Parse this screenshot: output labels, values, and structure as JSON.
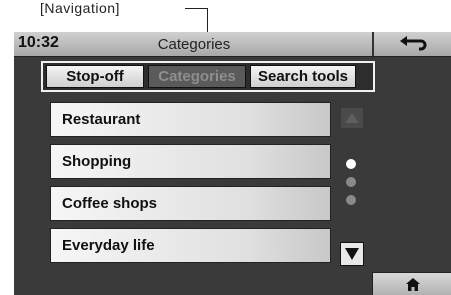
{
  "callout": {
    "label": "[Navigation]"
  },
  "header": {
    "time": "10:32",
    "title": "Categories"
  },
  "tabs": [
    {
      "label": "Stop-off",
      "state": "active"
    },
    {
      "label": "Categories",
      "state": "selected-dimmed"
    },
    {
      "label": "Search tools",
      "state": "active"
    }
  ],
  "list": {
    "items": [
      {
        "label": "Restaurant"
      },
      {
        "label": "Shopping"
      },
      {
        "label": "Coffee shops"
      },
      {
        "label": "Everyday life"
      }
    ]
  },
  "scroll": {
    "page": 1,
    "page_count": 3
  },
  "icons": {
    "back": "back-arrow-icon",
    "home": "home-icon",
    "up": "up-arrow-icon",
    "down": "down-arrow-icon"
  },
  "colors": {
    "screen_bg": "#3a3a3a",
    "item_bg": "#e6e6e6",
    "dot_active": "#ffffff",
    "dot_inactive": "#8a8a8a"
  }
}
